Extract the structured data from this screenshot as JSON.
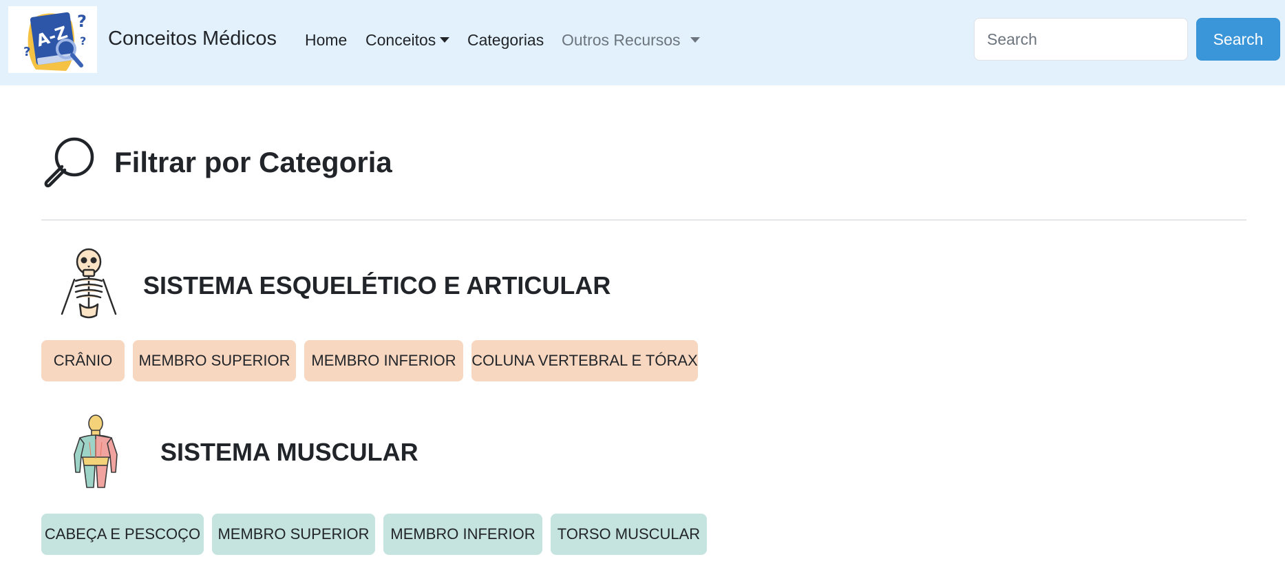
{
  "navbar": {
    "logo_icon": "medical-dictionary-logo",
    "brand": "Conceitos Médicos",
    "links": [
      {
        "label": "Home",
        "dropdown": false
      },
      {
        "label": "Conceitos",
        "dropdown": true
      },
      {
        "label": "Categorias",
        "dropdown": false
      },
      {
        "label": "Outros Recursos",
        "dropdown": true
      }
    ],
    "search": {
      "placeholder": "Search",
      "value": "",
      "button_label": "Search"
    }
  },
  "page": {
    "icon": "magnifier-icon",
    "title": "Filtrar por Categoria"
  },
  "sections": [
    {
      "icon": "skeleton-icon",
      "title": "SISTEMA ESQUELÉTICO E ARTICULAR",
      "chip_color": "#f8d7c0",
      "chips": [
        "CRÂNIO",
        "MEMBRO SUPERIOR",
        "MEMBRO INFERIOR",
        "COLUNA VERTEBRAL E TÓRAX"
      ]
    },
    {
      "icon": "muscular-body-icon",
      "title": "SISTEMA MUSCULAR",
      "chip_color": "#c6e4df",
      "chips": [
        "CABEÇA E PESCOÇO",
        "MEMBRO SUPERIOR",
        "MEMBRO INFERIOR",
        "TORSO MUSCULAR"
      ]
    }
  ],
  "colors": {
    "navbar_bg": "#e3f1fc",
    "search_button": "#3b96d9",
    "text": "#212529",
    "muted_link": "#6c757d"
  }
}
